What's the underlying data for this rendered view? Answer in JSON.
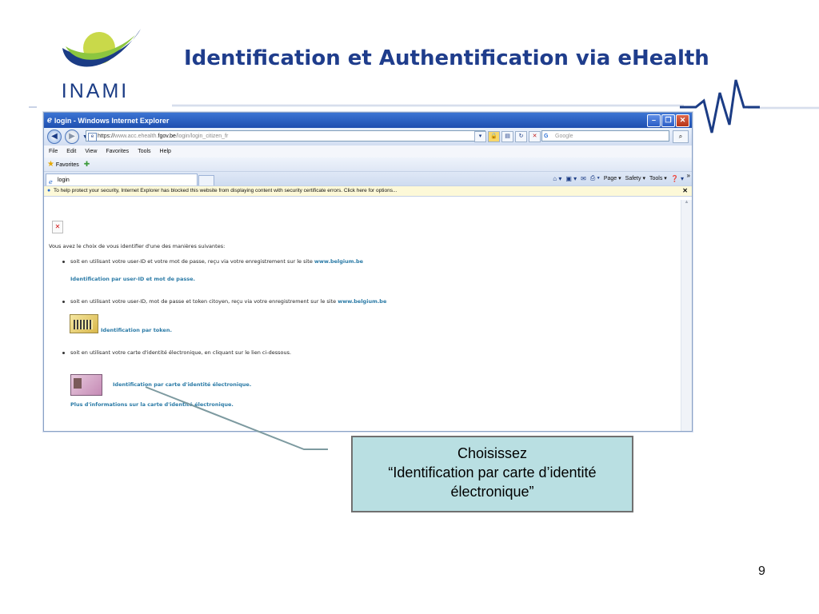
{
  "slide": {
    "logo_text": "INAMI",
    "title": "Identification et Authentification via eHealth",
    "page_number": "9"
  },
  "browser": {
    "window_title": "login - Windows Internet Explorer",
    "url_prefix": "https://",
    "url_dim1": "www.acc.ehealth.",
    "url_domain": "fgov.be",
    "url_path": "/login/login_citizen_fr",
    "search_placeholder": "Google",
    "menu": [
      "File",
      "Edit",
      "View",
      "Favorites",
      "Tools",
      "Help"
    ],
    "favorites_label": "Favorites",
    "tab_label": "login",
    "command_bar": {
      "page": "Page",
      "safety": "Safety",
      "tools": "Tools"
    },
    "infobar_text": "To help protect your security, Internet Explorer has blocked this website from displaying content with security certificate errors. Click here for options..."
  },
  "content": {
    "intro": "Vous avez le choix de vous identifier d'une des manières suivantes:",
    "option1_text": "soit en utilisant votre user-ID et votre mot de passe, reçu via votre enregistrement sur le site ",
    "option1_site": "www.belgium.be",
    "option1_link": "Identification par user-ID et mot de passe.",
    "option2_text": "soit en utilisant votre user-ID, mot de passe et token citoyen, reçu via votre enregistrement sur le site ",
    "option2_site": "www.belgium.be",
    "option2_link": "Identification par token.",
    "option3_text": "soit en utilisant votre carte d'identité électronique, en cliquant sur le lien ci-dessous.",
    "option3_link": "Identification par carte d'identité électronique.",
    "more_info_link": "Plus d'informations sur la carte d'identité électronique."
  },
  "callout": {
    "line1": "Choisissez",
    "line2": "“Identification par carte d’identité",
    "line3": "électronique”"
  },
  "colors": {
    "title": "#1f3d8c",
    "logo_green": "#8cc63f",
    "logo_blue": "#1b3c85",
    "callout_bg": "#b9dfe2",
    "link": "#2a7aa6"
  }
}
